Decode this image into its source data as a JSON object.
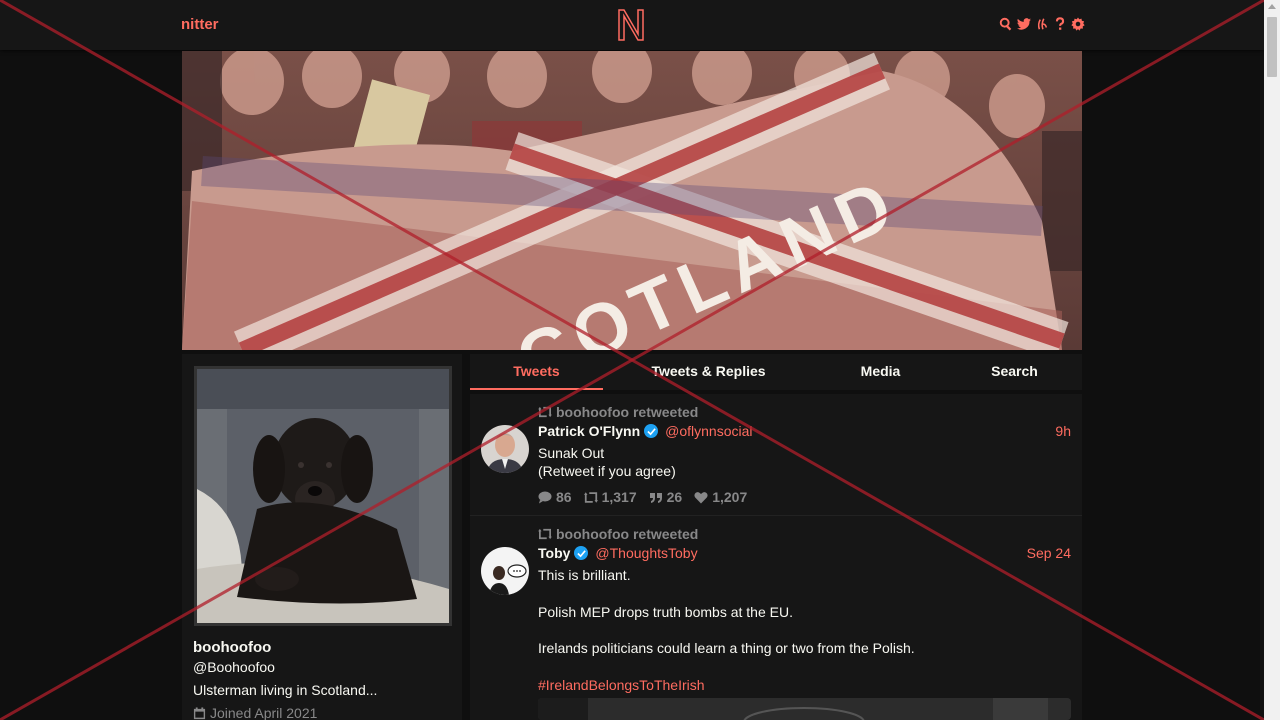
{
  "navbar": {
    "brand": "nitter",
    "logo_letter": "N",
    "icons": [
      "search-icon",
      "twitter-bird-icon",
      "rss-icon",
      "help-icon",
      "gear-icon"
    ]
  },
  "banner": {
    "flag_text": "SCOTLAND"
  },
  "profile": {
    "name": "boohoofoo",
    "handle": "@Boohoofoo",
    "bio": "Ulsterman living in Scotland...",
    "joined": "Joined April 2021"
  },
  "tabs": [
    {
      "label": "Tweets",
      "active": true
    },
    {
      "label": "Tweets & Replies",
      "active": false
    },
    {
      "label": "Media",
      "active": false
    },
    {
      "label": "Search",
      "active": false
    }
  ],
  "tweets": [
    {
      "retweeted_by": "boohoofoo retweeted",
      "fullname": "Patrick O'Flynn",
      "username": "@oflynnsocial",
      "date": "9h",
      "text_lines": [
        "Sunak Out",
        "(Retweet if you agree)"
      ],
      "stats": {
        "replies": "86",
        "retweets": "1,317",
        "quotes": "26",
        "likes": "1,207"
      }
    },
    {
      "retweeted_by": "boohoofoo retweeted",
      "fullname": "Toby",
      "username": "@ThoughtsToby",
      "date": "Sep 24",
      "text_lines": [
        "This is brilliant.",
        "Polish MEP drops truth bombs at the EU.",
        "Irelands politicians could learn a thing or two from the Polish."
      ],
      "hashtag": "#IrelandBelongsToTheIrish"
    }
  ],
  "colors": {
    "accent": "#ff6c60",
    "background": "#0f0f0f",
    "panel": "#161616",
    "muted": "#888889",
    "overlay_cross": "#b01e2a"
  }
}
